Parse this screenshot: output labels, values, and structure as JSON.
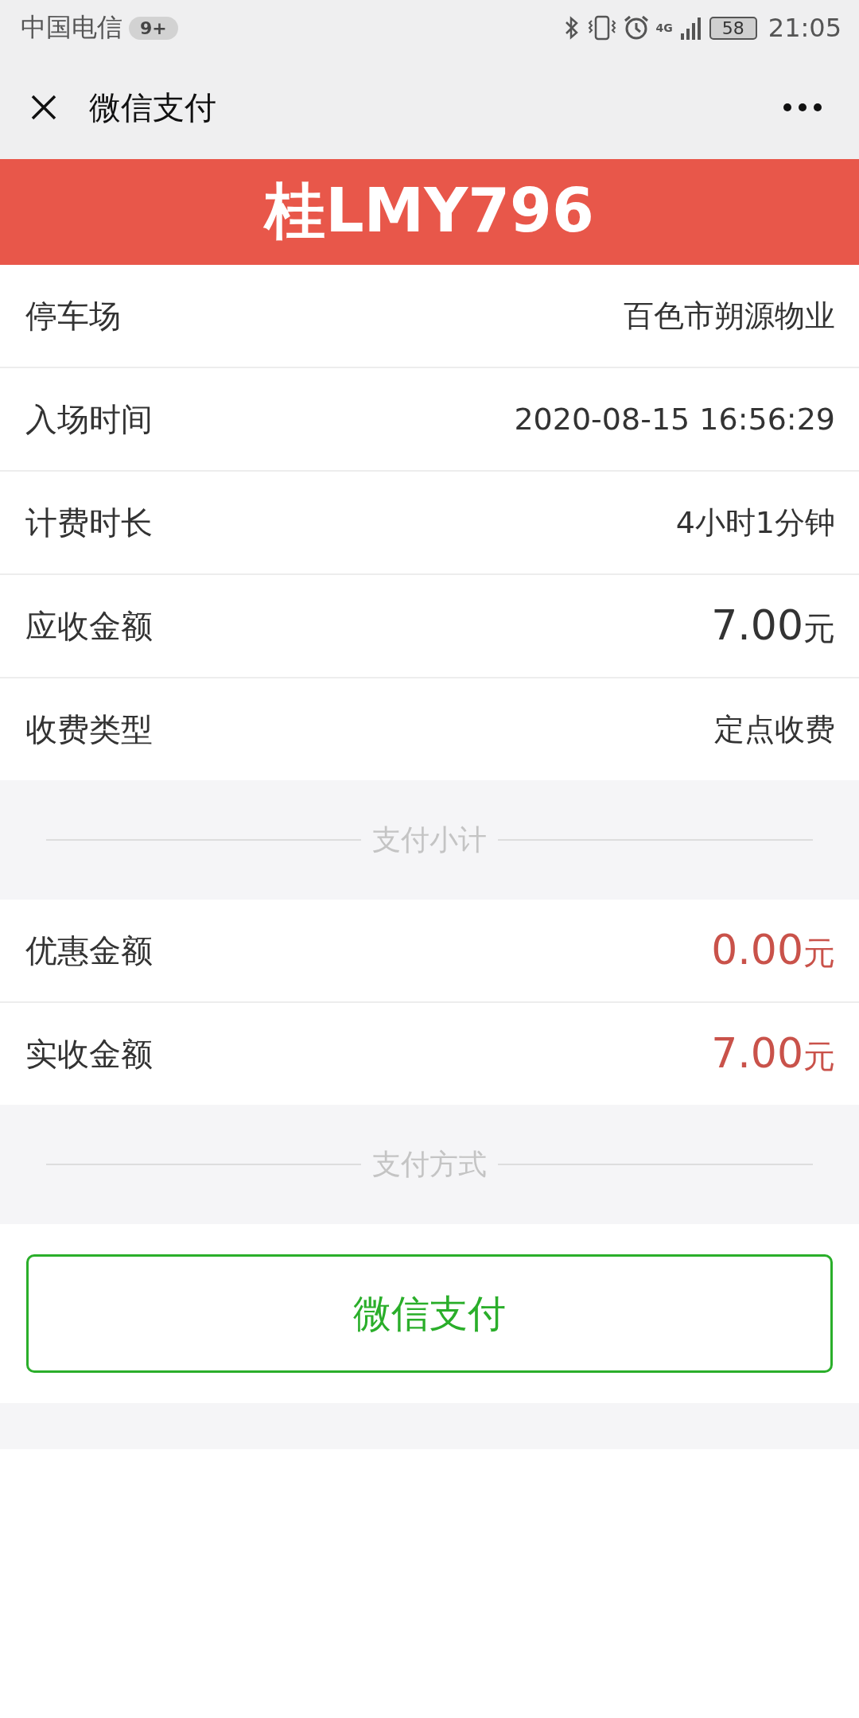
{
  "status_bar": {
    "carrier": "中国电信",
    "badge": "9+",
    "network": "4G",
    "battery": "58",
    "time": "21:05"
  },
  "nav": {
    "title": "微信支付"
  },
  "plate": "桂LMY796",
  "details": [
    {
      "label": "停车场",
      "value": "百色市朔源物业",
      "kind": "text"
    },
    {
      "label": "入场时间",
      "value": "2020-08-15 16:56:29",
      "kind": "text"
    },
    {
      "label": "计费时长",
      "value": "4小时1分钟",
      "kind": "text"
    },
    {
      "label": "应收金额",
      "value": "7.00",
      "unit": "元",
      "kind": "amount"
    },
    {
      "label": "收费类型",
      "value": "定点收费",
      "kind": "text"
    }
  ],
  "subtotal_heading": "支付小计",
  "subtotal": [
    {
      "label": "优惠金额",
      "value": "0.00",
      "unit": "元",
      "kind": "due"
    },
    {
      "label": "实收金额",
      "value": "7.00",
      "unit": "元",
      "kind": "due"
    }
  ],
  "method_heading": "支付方式",
  "pay_button": "微信支付"
}
